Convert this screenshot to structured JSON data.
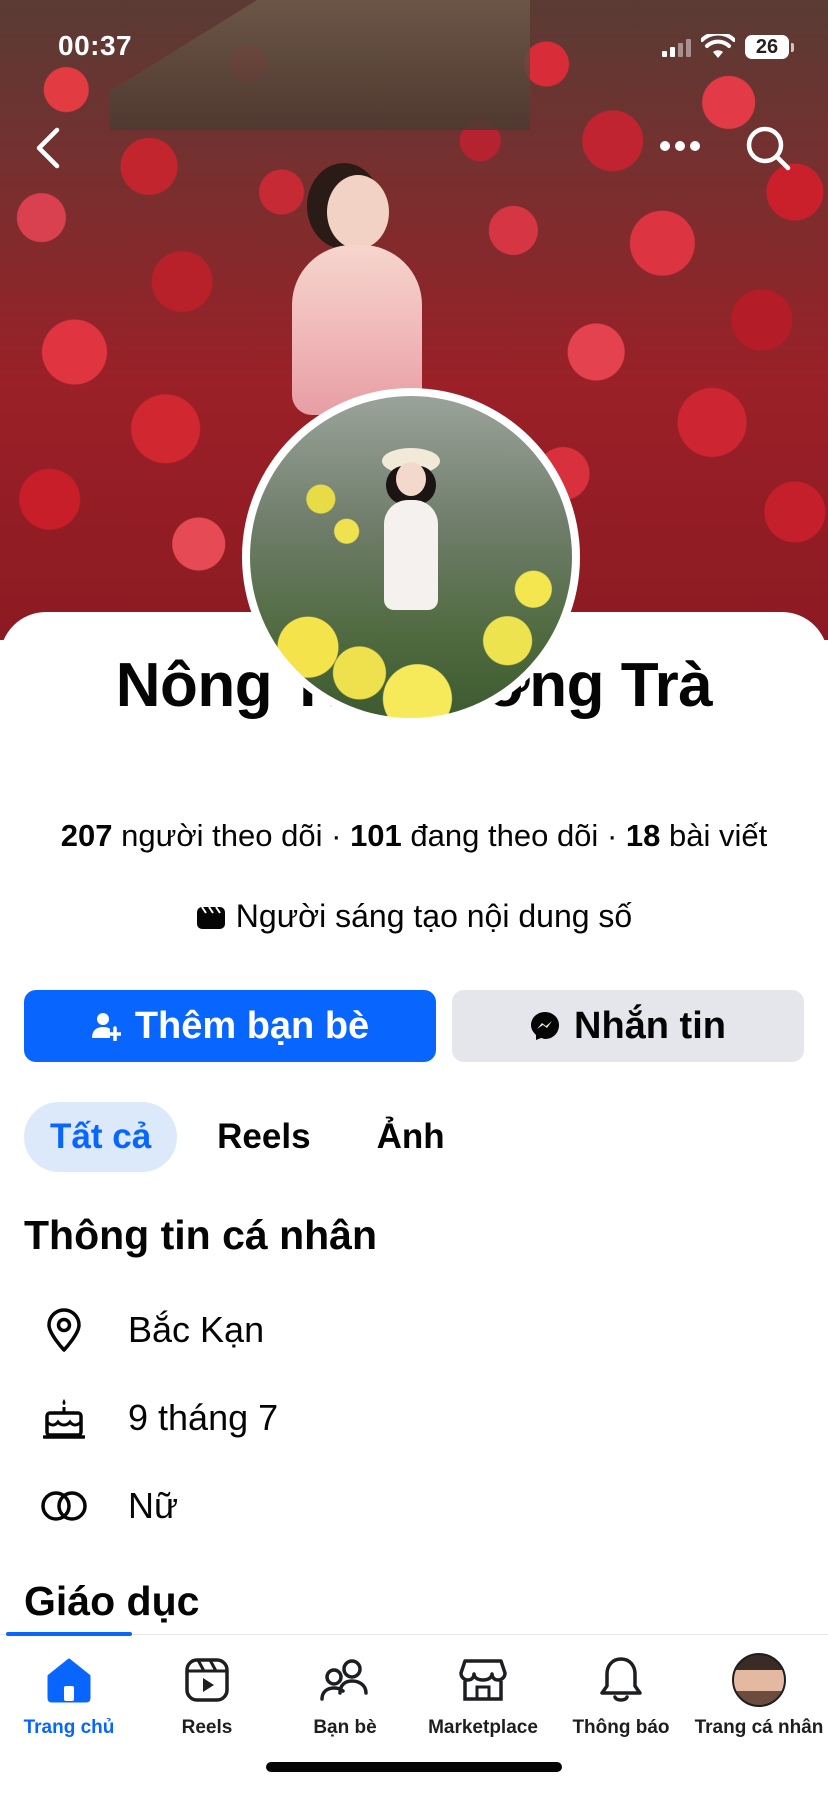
{
  "status_bar": {
    "time": "00:37",
    "battery": "26"
  },
  "top_nav": {
    "back_icon": "chevron-left-icon",
    "more_icon": "more-horizontal-icon",
    "search_icon": "search-icon"
  },
  "profile": {
    "name": "Nông Thị Hương Trà",
    "stats": {
      "followers_count": "207",
      "followers_label": "người theo dõi",
      "following_count": "101",
      "following_label": "đang theo dõi",
      "posts_count": "18",
      "posts_label": "bài viết",
      "separator": "·"
    },
    "category": "Người sáng tạo nội dung số",
    "category_icon": "clapperboard-icon"
  },
  "actions": {
    "add_friend": "Thêm bạn bè",
    "message": "Nhắn tin"
  },
  "tabs": [
    {
      "label": "Tất cả",
      "active": true
    },
    {
      "label": "Reels",
      "active": false
    },
    {
      "label": "Ảnh",
      "active": false
    }
  ],
  "personal_info": {
    "title": "Thông tin cá nhân",
    "items": [
      {
        "icon": "location-pin-icon",
        "text": "Bắc Kạn"
      },
      {
        "icon": "birthday-cake-icon",
        "text": "9 tháng 7"
      },
      {
        "icon": "gender-icon",
        "text": "Nữ"
      }
    ]
  },
  "education": {
    "title": "Giáo dục"
  },
  "bottom_nav": [
    {
      "label": "Trang chủ",
      "icon": "home-icon",
      "active": true
    },
    {
      "label": "Reels",
      "icon": "reels-icon",
      "active": false
    },
    {
      "label": "Bạn bè",
      "icon": "friends-icon",
      "active": false
    },
    {
      "label": "Marketplace",
      "icon": "marketplace-icon",
      "active": false
    },
    {
      "label": "Thông báo",
      "icon": "bell-icon",
      "active": false
    },
    {
      "label": "Trang cá nhân",
      "icon": "profile-avatar",
      "active": false
    }
  ],
  "colors": {
    "accent": "#0866ff",
    "secondary_button": "#e4e6eb",
    "active_tab_bg": "#dce9fb",
    "text": "#050505"
  }
}
